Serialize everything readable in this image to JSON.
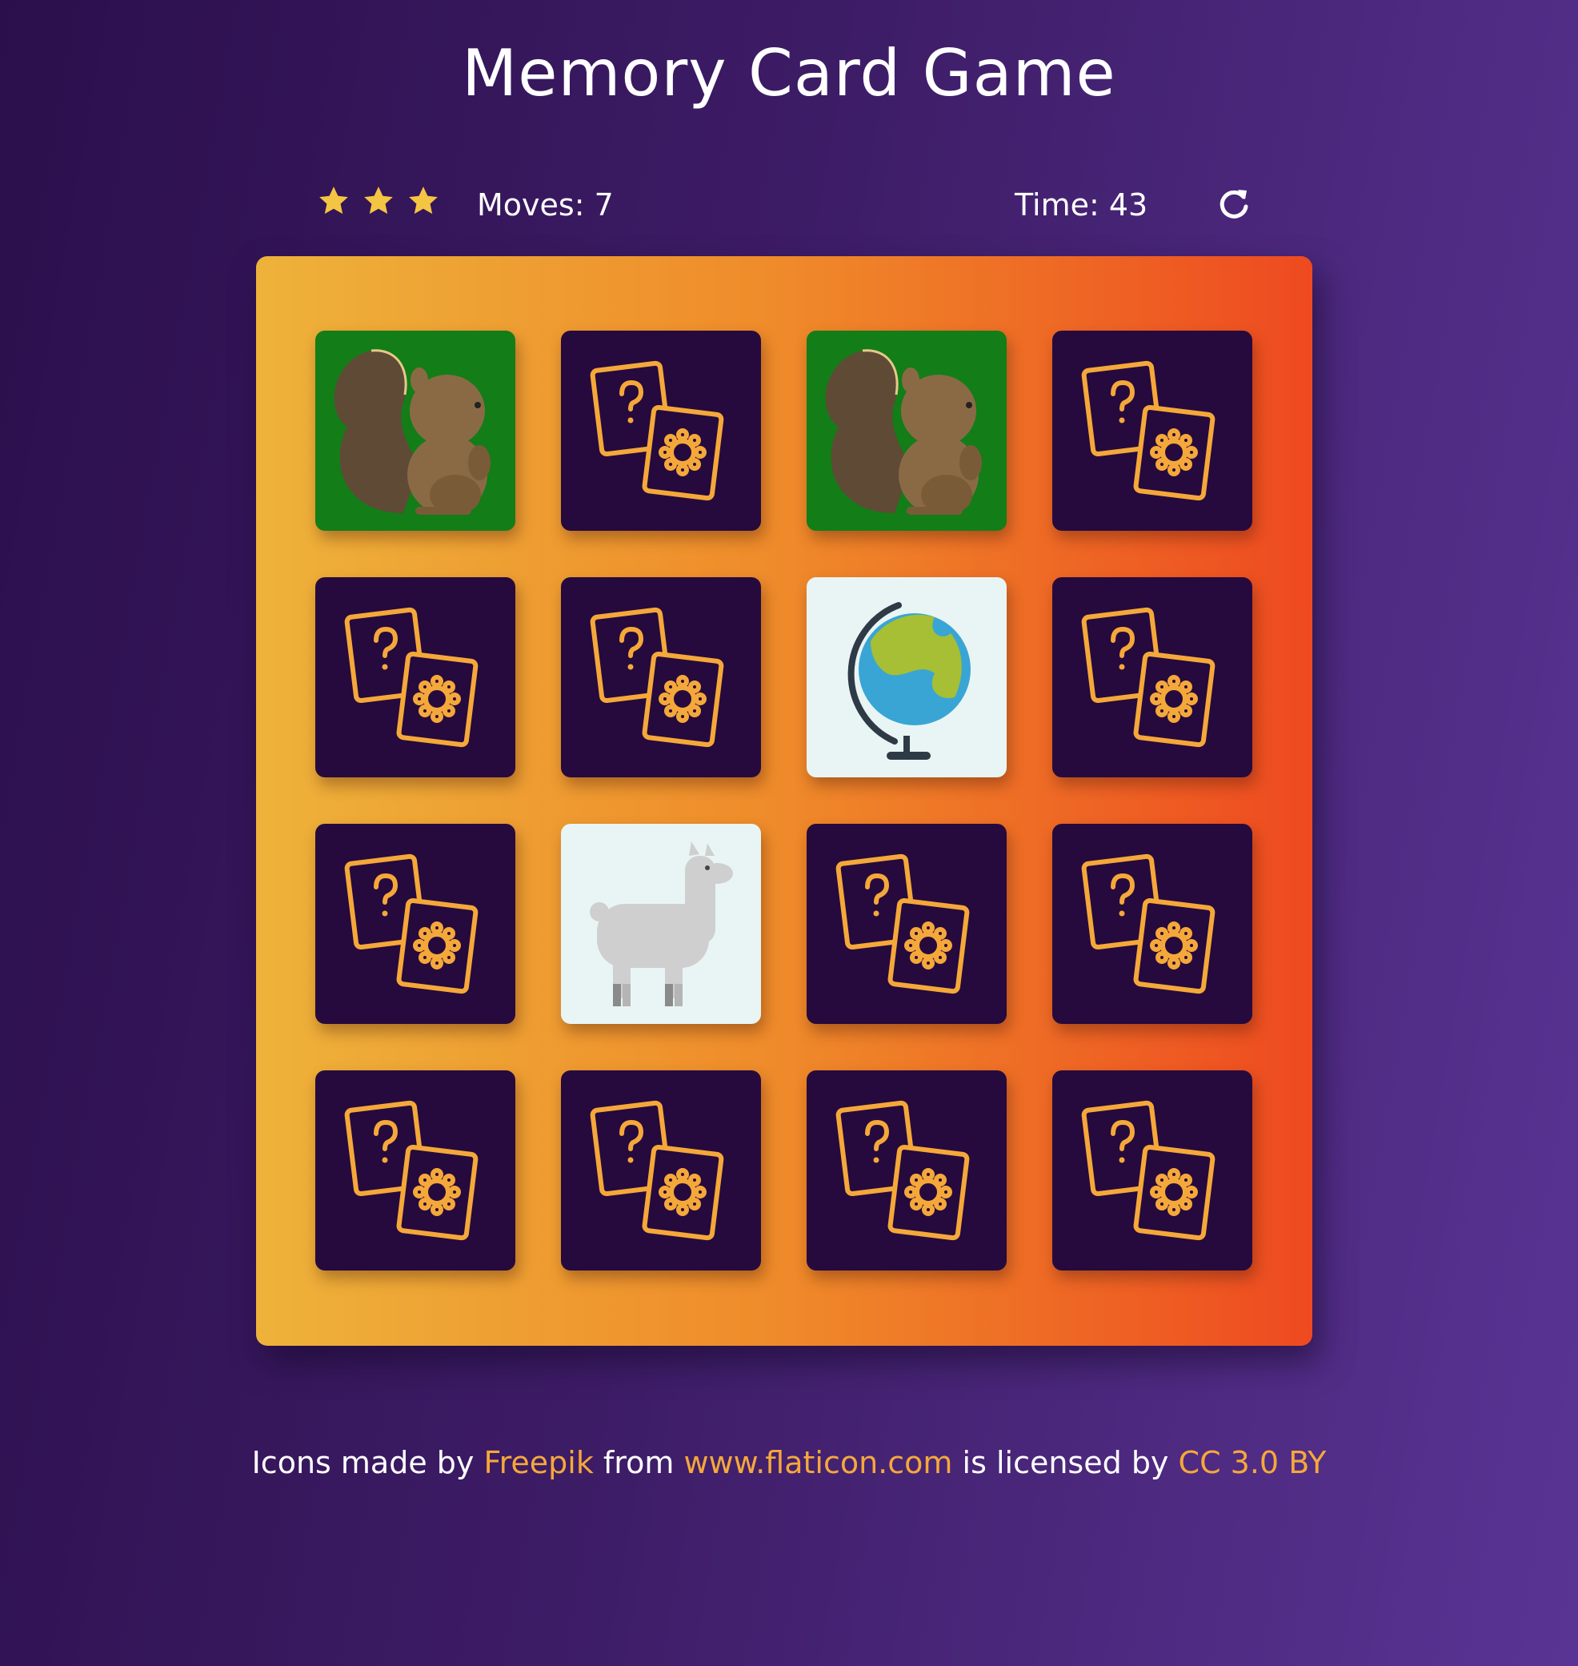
{
  "header": {
    "title": "Memory Card Game"
  },
  "score_panel": {
    "stars": 3,
    "moves_label": "Moves: 7",
    "time_label": "Time: 43",
    "restart_icon": "restart-icon"
  },
  "deck": {
    "rows": 4,
    "cols": 4,
    "cards": [
      {
        "state": "match",
        "face": "squirrel"
      },
      {
        "state": "back",
        "face": "card-back"
      },
      {
        "state": "match",
        "face": "squirrel"
      },
      {
        "state": "back",
        "face": "card-back"
      },
      {
        "state": "back",
        "face": "card-back"
      },
      {
        "state": "back",
        "face": "card-back"
      },
      {
        "state": "open",
        "face": "globe"
      },
      {
        "state": "back",
        "face": "card-back"
      },
      {
        "state": "back",
        "face": "card-back"
      },
      {
        "state": "open",
        "face": "llama"
      },
      {
        "state": "back",
        "face": "card-back"
      },
      {
        "state": "back",
        "face": "card-back"
      },
      {
        "state": "back",
        "face": "card-back"
      },
      {
        "state": "back",
        "face": "card-back"
      },
      {
        "state": "back",
        "face": "card-back"
      },
      {
        "state": "back",
        "face": "card-back"
      }
    ]
  },
  "footer": {
    "text1": "Icons made by",
    "link1": "Freepik",
    "text2": "from",
    "link2": "www.flaticon.com",
    "text3": "is licensed by",
    "link3": "CC 3.0 BY"
  },
  "colors": {
    "card_back": "#260a3d",
    "card_match": "#137d18",
    "card_open": "#e8f5f4",
    "accent": "#f5a83a",
    "star": "#f4c542"
  }
}
